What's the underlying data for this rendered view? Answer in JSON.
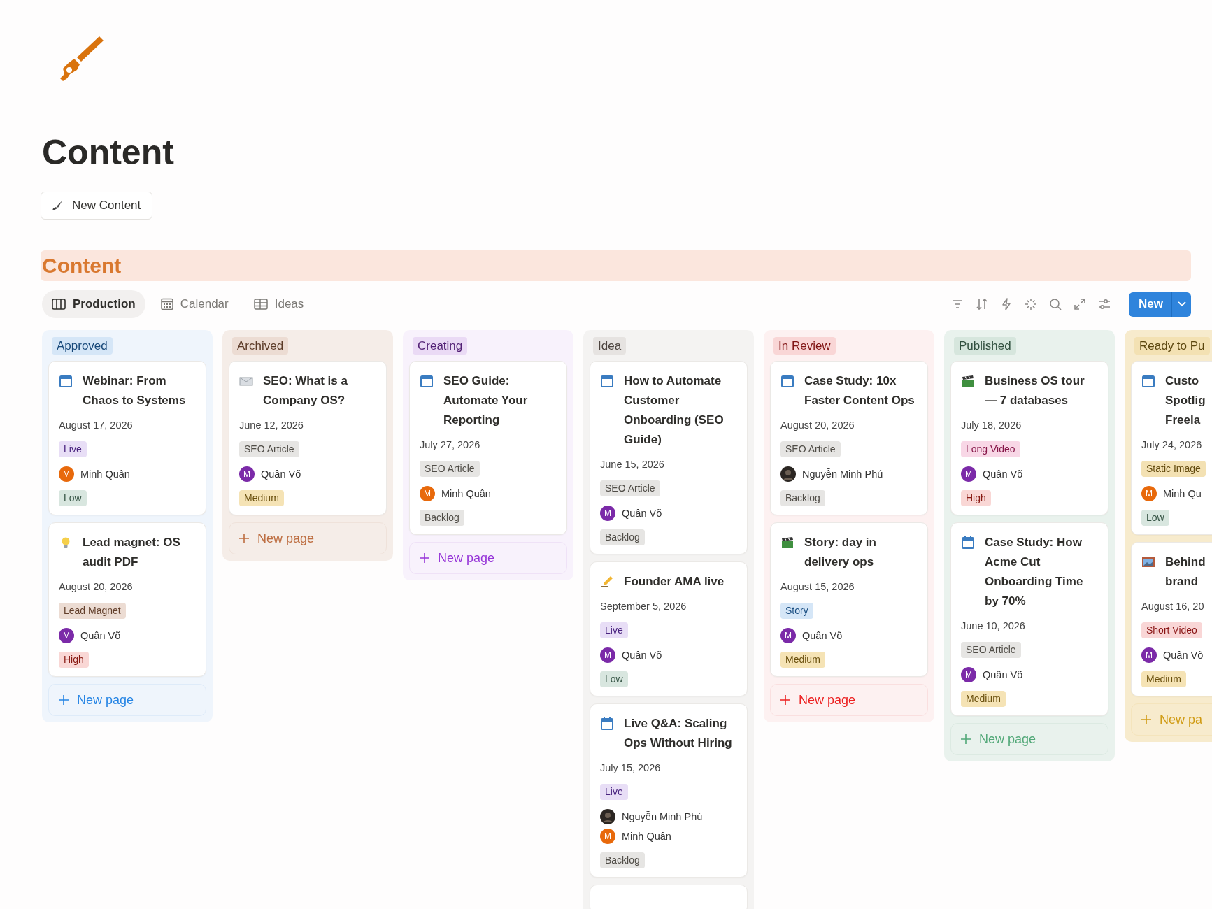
{
  "page": {
    "title": "Content",
    "new_button": "New Content"
  },
  "database": {
    "title": "Content"
  },
  "views": [
    {
      "label": "Production",
      "kind": "board",
      "selected": true
    },
    {
      "label": "Calendar",
      "kind": "calendar",
      "selected": false
    },
    {
      "label": "Ideas",
      "kind": "table",
      "selected": false
    }
  ],
  "toolbar": {
    "new_button": "New"
  },
  "columns": [
    {
      "name": "Approved",
      "color": "#d5e6f7",
      "new_page": "New page",
      "cards": [
        {
          "kind": "calendar",
          "title": "Webinar: From Chaos to Systems",
          "date": "August 17, 2026",
          "props": [
            {
              "kind": "tag",
              "text": "Live",
              "color": "#e8def6"
            },
            {
              "kind": "person",
              "people": [
                {
                  "kind": "initial",
                  "name": "Minh Quân",
                  "initial": "M",
                  "color": "#e8690b"
                }
              ]
            },
            {
              "kind": "tag",
              "text": "Low",
              "color": "#d8e6df"
            }
          ]
        },
        {
          "kind": "bulb",
          "title": "Lead magnet: OS audit PDF",
          "date": "August 20, 2026",
          "props": [
            {
              "kind": "tag",
              "text": "Lead Magnet",
              "color": "#ecdcd3"
            },
            {
              "kind": "person",
              "people": [
                {
                  "kind": "initial",
                  "name": "Quân Võ",
                  "initial": "M",
                  "color": "#7b2aa8"
                }
              ]
            },
            {
              "kind": "tag",
              "text": "High",
              "color": "#f9d7d5"
            }
          ]
        }
      ]
    },
    {
      "name": "Archived",
      "color": "#ecdcd3",
      "new_page": "New page",
      "cards": [
        {
          "kind": "envelope",
          "title": "SEO: What is a Company OS?",
          "date": "June 12, 2026",
          "props": [
            {
              "kind": "tag",
              "text": "SEO Article",
              "color": "#e6e5e3"
            },
            {
              "kind": "person",
              "people": [
                {
                  "kind": "initial",
                  "name": "Quân Võ",
                  "initial": "M",
                  "color": "#7b2aa8"
                }
              ]
            },
            {
              "kind": "tag",
              "text": "Medium",
              "color": "#f5e3b5"
            }
          ]
        }
      ]
    },
    {
      "name": "Creating",
      "color": "#eadaf5",
      "new_page": "New page",
      "cards": [
        {
          "kind": "calendar",
          "title": "SEO Guide: Automate Your Reporting",
          "date": "July 27, 2026",
          "props": [
            {
              "kind": "tag",
              "text": "SEO Article",
              "color": "#e6e5e3"
            },
            {
              "kind": "person",
              "people": [
                {
                  "kind": "initial",
                  "name": "Minh Quân",
                  "initial": "M",
                  "color": "#e8690b"
                }
              ]
            },
            {
              "kind": "tag",
              "text": "Backlog",
              "color": "#e6e5e3"
            }
          ]
        }
      ]
    },
    {
      "name": "Idea",
      "color": "#e6e3e1",
      "cards": [
        {
          "kind": "calendar",
          "title": "How to Automate Customer Onboarding (SEO Guide)",
          "date": "June 15, 2026",
          "props": [
            {
              "kind": "tag",
              "text": "SEO Article",
              "color": "#e6e5e3"
            },
            {
              "kind": "person",
              "people": [
                {
                  "kind": "initial",
                  "name": "Quân Võ",
                  "initial": "M",
                  "color": "#7b2aa8"
                }
              ]
            },
            {
              "kind": "tag",
              "text": "Backlog",
              "color": "#e6e5e3"
            }
          ]
        },
        {
          "kind": "writing",
          "title": "Founder AMA live",
          "date": "September 5, 2026",
          "props": [
            {
              "kind": "tag",
              "text": "Live",
              "color": "#e8def6"
            },
            {
              "kind": "person",
              "people": [
                {
                  "kind": "initial",
                  "name": "Quân Võ",
                  "initial": "M",
                  "color": "#7b2aa8"
                }
              ]
            },
            {
              "kind": "tag",
              "text": "Low",
              "color": "#d8e6df"
            }
          ]
        },
        {
          "kind": "calendar",
          "title": "Live Q&A: Scaling Ops Without Hiring",
          "date": "July 15, 2026",
          "props": [
            {
              "kind": "tag",
              "text": "Live",
              "color": "#e8def6"
            },
            {
              "kind": "person",
              "people": [
                {
                  "kind": "photo",
                  "name": "Nguyễn Minh Phú"
                },
                {
                  "kind": "initial",
                  "name": "Minh Quân",
                  "initial": "M",
                  "color": "#e8690b"
                }
              ]
            },
            {
              "kind": "tag",
              "text": "Backlog",
              "color": "#e6e5e3"
            }
          ]
        },
        {
          "kind": "stub"
        }
      ]
    },
    {
      "name": "In Review",
      "color": "#f9d6d6",
      "new_page": "New page",
      "cards": [
        {
          "kind": "calendar",
          "title": "Case Study: 10x Faster Content Ops",
          "date": "August 20, 2026",
          "props": [
            {
              "kind": "tag",
              "text": "SEO Article",
              "color": "#e6e5e3"
            },
            {
              "kind": "person",
              "people": [
                {
                  "kind": "photo",
                  "name": "Nguyễn Minh Phú"
                }
              ]
            },
            {
              "kind": "tag",
              "text": "Backlog",
              "color": "#e6e5e3"
            }
          ]
        },
        {
          "kind": "clapper",
          "title": "Story: day in delivery ops",
          "date": "August 15, 2026",
          "props": [
            {
              "kind": "tag",
              "text": "Story",
              "color": "#d5e6f7"
            },
            {
              "kind": "person",
              "people": [
                {
                  "kind": "initial",
                  "name": "Quân Võ",
                  "initial": "M",
                  "color": "#7b2aa8"
                }
              ]
            },
            {
              "kind": "tag",
              "text": "Medium",
              "color": "#f5e3b5"
            }
          ]
        }
      ]
    },
    {
      "name": "Published",
      "color": "#d6e6dd",
      "new_page": "New page",
      "cards": [
        {
          "kind": "clapper",
          "title": "Business OS tour — 7 databases",
          "date": "July 18, 2026",
          "props": [
            {
              "kind": "tag",
              "text": "Long Video",
              "color": "#f8d7e6"
            },
            {
              "kind": "person",
              "people": [
                {
                  "kind": "initial",
                  "name": "Quân Võ",
                  "initial": "M",
                  "color": "#7b2aa8"
                }
              ]
            },
            {
              "kind": "tag",
              "text": "High",
              "color": "#f9d7d5"
            }
          ]
        },
        {
          "kind": "calendar",
          "title": "Case Study: How Acme Cut Onboarding Time by 70%",
          "date": "June 10, 2026",
          "props": [
            {
              "kind": "tag",
              "text": "SEO Article",
              "color": "#e6e5e3"
            },
            {
              "kind": "person",
              "people": [
                {
                  "kind": "initial",
                  "name": "Quân Võ",
                  "initial": "M",
                  "color": "#7b2aa8"
                }
              ]
            },
            {
              "kind": "tag",
              "text": "Medium",
              "color": "#f5e3b5"
            }
          ]
        }
      ]
    },
    {
      "name": "Ready to Pu",
      "color": "#f3e1b3",
      "new_page": "New pa",
      "cards": [
        {
          "kind": "calendar",
          "title_lines": [
            "Custo",
            "Spotlig",
            "Freela"
          ],
          "date": "July 24, 2026",
          "props": [
            {
              "kind": "tag",
              "text": "Static Image",
              "color": "#f3e1b3"
            },
            {
              "kind": "person",
              "people": [
                {
                  "kind": "initial",
                  "name": "Minh Qu",
                  "initial": "M",
                  "color": "#e8690b"
                }
              ]
            },
            {
              "kind": "tag",
              "text": "Low",
              "color": "#d8e6df"
            }
          ]
        },
        {
          "kind": "picture",
          "title_lines": [
            "Behind",
            "brand"
          ],
          "date": "August 16, 20",
          "props": [
            {
              "kind": "tag",
              "text": "Short Video",
              "color": "#f9d6d6"
            },
            {
              "kind": "person",
              "people": [
                {
                  "kind": "initial",
                  "name": "Quân Võ",
                  "initial": "M",
                  "color": "#7b2aa8"
                }
              ]
            },
            {
              "kind": "tag",
              "text": "Medium",
              "color": "#f5e3b5"
            }
          ]
        }
      ]
    }
  ]
}
